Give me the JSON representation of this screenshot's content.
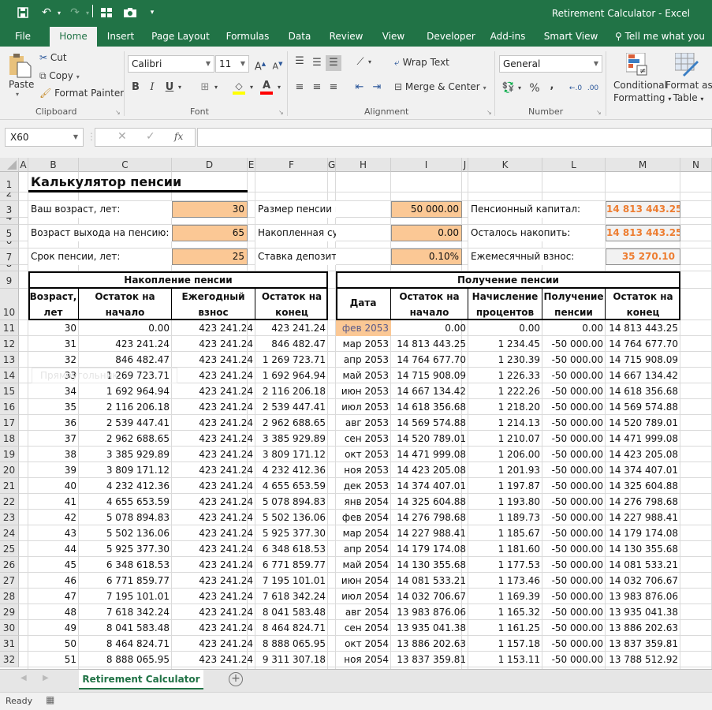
{
  "window": {
    "title": "Retirement Calculator - Excel"
  },
  "ribbon_tabs": [
    "File",
    "Home",
    "Insert",
    "Page Layout",
    "Formulas",
    "Data",
    "Review",
    "View",
    "Developer",
    "Add-ins",
    "Smart View"
  ],
  "tell_me": "Tell me what you w",
  "clipboard": {
    "paste": "Paste",
    "cut": "Cut",
    "copy": "Copy",
    "format_painter": "Format Painter",
    "group": "Clipboard"
  },
  "font": {
    "name": "Calibri",
    "size": "11",
    "group": "Font",
    "bold": "B",
    "italic": "I",
    "underline": "U"
  },
  "alignment": {
    "wrap": "Wrap Text",
    "merge": "Merge & Center",
    "group": "Alignment"
  },
  "number": {
    "format": "General",
    "percent": "%",
    "comma": ",",
    "group": "Number"
  },
  "styles": {
    "conditional_1": "Conditional",
    "conditional_2": "Formatting",
    "format_table_1": "Format as",
    "format_table_2": "Table"
  },
  "formula_bar": {
    "name_box": "X60",
    "fx": "fx",
    "value": ""
  },
  "columns": [
    "A",
    "B",
    "C",
    "D",
    "E",
    "F",
    "G",
    "H",
    "I",
    "J",
    "K",
    "L",
    "M",
    "N"
  ],
  "rows": [
    "1",
    "2",
    "3",
    "4",
    "5",
    "6",
    "7",
    "8",
    "9",
    "10",
    "11",
    "12",
    "13",
    "14",
    "15",
    "16",
    "17",
    "18",
    "19",
    "20",
    "21",
    "22",
    "23",
    "24",
    "25",
    "26",
    "27",
    "28",
    "29",
    "30",
    "31",
    "32"
  ],
  "sheet": {
    "title": "Калькулятор пенсии",
    "inputs": [
      {
        "label": "Ваш возраст, лет:",
        "value": "30"
      },
      {
        "label": "Возраст выхода на пенсию:",
        "value": "65"
      },
      {
        "label": "Срок пенсии, лет:",
        "value": "25"
      }
    ],
    "inputs2": [
      {
        "label": "Размер пенсии в месяц:",
        "value": "50 000.00"
      },
      {
        "label": "Накопленная сумма:",
        "value": "0.00"
      },
      {
        "label": "Ставка депозита, % год.:",
        "value": "0.10%"
      }
    ],
    "outputs": [
      {
        "label": "Пенсионный капитал:",
        "value": "14 813 443.25"
      },
      {
        "label": "Осталось накопить:",
        "value": "14 813 443.25"
      },
      {
        "label": "Ежемесячный взнос:",
        "value": "35 270.10"
      }
    ],
    "output_color": "#ed7d31",
    "input_color": "#fbc895",
    "ghost_shape": "Прямоугольник",
    "accum": {
      "title": "Накопление пенсии",
      "headers": [
        [
          "Возраст,",
          "лет"
        ],
        [
          "Остаток на",
          "начало"
        ],
        [
          "Ежегодный",
          "взнос"
        ],
        [
          "Остаток на",
          "конец"
        ]
      ],
      "rows": [
        [
          "30",
          "0.00",
          "423 241.24",
          "423 241.24"
        ],
        [
          "31",
          "423 241.24",
          "423 241.24",
          "846 482.47"
        ],
        [
          "32",
          "846 482.47",
          "423 241.24",
          "1 269 723.71"
        ],
        [
          "33",
          "1 269 723.71",
          "423 241.24",
          "1 692 964.94"
        ],
        [
          "34",
          "1 692 964.94",
          "423 241.24",
          "2 116 206.18"
        ],
        [
          "35",
          "2 116 206.18",
          "423 241.24",
          "2 539 447.41"
        ],
        [
          "36",
          "2 539 447.41",
          "423 241.24",
          "2 962 688.65"
        ],
        [
          "37",
          "2 962 688.65",
          "423 241.24",
          "3 385 929.89"
        ],
        [
          "38",
          "3 385 929.89",
          "423 241.24",
          "3 809 171.12"
        ],
        [
          "39",
          "3 809 171.12",
          "423 241.24",
          "4 232 412.36"
        ],
        [
          "40",
          "4 232 412.36",
          "423 241.24",
          "4 655 653.59"
        ],
        [
          "41",
          "4 655 653.59",
          "423 241.24",
          "5 078 894.83"
        ],
        [
          "42",
          "5 078 894.83",
          "423 241.24",
          "5 502 136.06"
        ],
        [
          "43",
          "5 502 136.06",
          "423 241.24",
          "5 925 377.30"
        ],
        [
          "44",
          "5 925 377.30",
          "423 241.24",
          "6 348 618.53"
        ],
        [
          "45",
          "6 348 618.53",
          "423 241.24",
          "6 771 859.77"
        ],
        [
          "46",
          "6 771 859.77",
          "423 241.24",
          "7 195 101.01"
        ],
        [
          "47",
          "7 195 101.01",
          "423 241.24",
          "7 618 342.24"
        ],
        [
          "48",
          "7 618 342.24",
          "423 241.24",
          "8 041 583.48"
        ],
        [
          "49",
          "8 041 583.48",
          "423 241.24",
          "8 464 824.71"
        ],
        [
          "50",
          "8 464 824.71",
          "423 241.24",
          "8 888 065.95"
        ],
        [
          "51",
          "8 888 065.95",
          "423 241.24",
          "9 311 307.18"
        ]
      ]
    },
    "payout": {
      "title": "Получение пенсии",
      "headers": [
        [
          "Дата"
        ],
        [
          "Остаток на",
          "начало"
        ],
        [
          "Начисление",
          "процентов"
        ],
        [
          "Получение",
          "пенсии"
        ],
        [
          "Остаток на",
          "конец"
        ]
      ],
      "rows": [
        [
          "фев 2053",
          "0.00",
          "0.00",
          "0.00",
          "14 813 443.25"
        ],
        [
          "мар 2053",
          "14 813 443.25",
          "1 234.45",
          "-50 000.00",
          "14 764 677.70"
        ],
        [
          "апр 2053",
          "14 764 677.70",
          "1 230.39",
          "-50 000.00",
          "14 715 908.09"
        ],
        [
          "май 2053",
          "14 715 908.09",
          "1 226.33",
          "-50 000.00",
          "14 667 134.42"
        ],
        [
          "июн 2053",
          "14 667 134.42",
          "1 222.26",
          "-50 000.00",
          "14 618 356.68"
        ],
        [
          "июл 2053",
          "14 618 356.68",
          "1 218.20",
          "-50 000.00",
          "14 569 574.88"
        ],
        [
          "авг 2053",
          "14 569 574.88",
          "1 214.13",
          "-50 000.00",
          "14 520 789.01"
        ],
        [
          "сен 2053",
          "14 520 789.01",
          "1 210.07",
          "-50 000.00",
          "14 471 999.08"
        ],
        [
          "окт 2053",
          "14 471 999.08",
          "1 206.00",
          "-50 000.00",
          "14 423 205.08"
        ],
        [
          "ноя 2053",
          "14 423 205.08",
          "1 201.93",
          "-50 000.00",
          "14 374 407.01"
        ],
        [
          "дек 2053",
          "14 374 407.01",
          "1 197.87",
          "-50 000.00",
          "14 325 604.88"
        ],
        [
          "янв 2054",
          "14 325 604.88",
          "1 193.80",
          "-50 000.00",
          "14 276 798.68"
        ],
        [
          "фев 2054",
          "14 276 798.68",
          "1 189.73",
          "-50 000.00",
          "14 227 988.41"
        ],
        [
          "мар 2054",
          "14 227 988.41",
          "1 185.67",
          "-50 000.00",
          "14 179 174.08"
        ],
        [
          "апр 2054",
          "14 179 174.08",
          "1 181.60",
          "-50 000.00",
          "14 130 355.68"
        ],
        [
          "май 2054",
          "14 130 355.68",
          "1 177.53",
          "-50 000.00",
          "14 081 533.21"
        ],
        [
          "июн 2054",
          "14 081 533.21",
          "1 173.46",
          "-50 000.00",
          "14 032 706.67"
        ],
        [
          "июл 2054",
          "14 032 706.67",
          "1 169.39",
          "-50 000.00",
          "13 983 876.06"
        ],
        [
          "авг 2054",
          "13 983 876.06",
          "1 165.32",
          "-50 000.00",
          "13 935 041.38"
        ],
        [
          "сен 2054",
          "13 935 041.38",
          "1 161.25",
          "-50 000.00",
          "13 886 202.63"
        ],
        [
          "окт 2054",
          "13 886 202.63",
          "1 157.18",
          "-50 000.00",
          "13 837 359.81"
        ],
        [
          "ноя 2054",
          "13 837 359.81",
          "1 153.11",
          "-50 000.00",
          "13 788 512.92"
        ]
      ]
    }
  },
  "sheet_tabs": [
    "Retirement Calculator"
  ],
  "status": {
    "text": "Ready"
  }
}
